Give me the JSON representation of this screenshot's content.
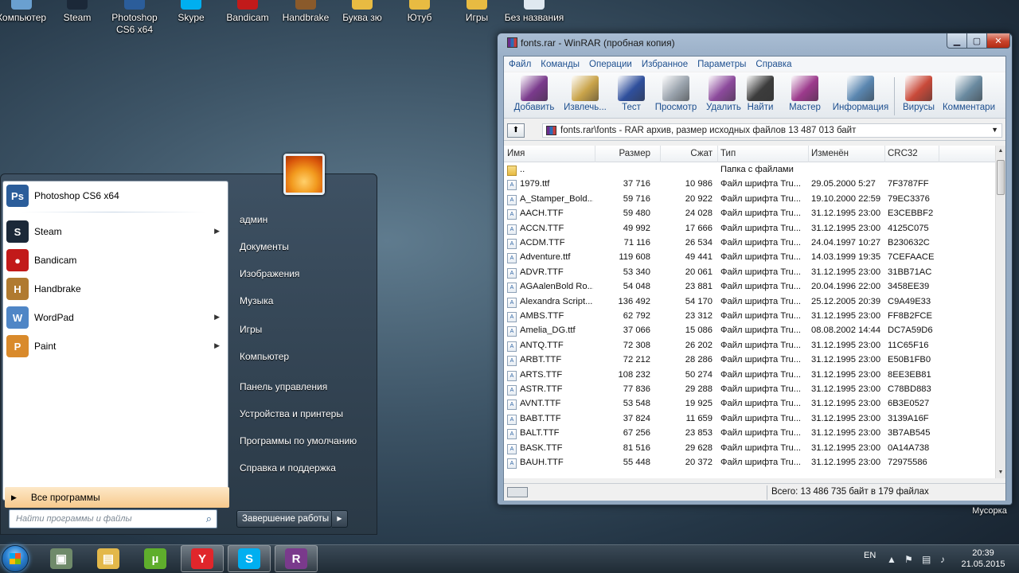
{
  "desktop_icons": [
    {
      "label": "Компьютер",
      "icon": "computer-icon",
      "color": "#6aa0d0"
    },
    {
      "label": "Steam",
      "icon": "steam-icon",
      "color": "#1b2838"
    },
    {
      "label": "Photoshop CS6 x64",
      "icon": "photoshop-icon",
      "color": "#2b5d9a"
    },
    {
      "label": "Skype",
      "icon": "skype-icon",
      "color": "#00aff0"
    },
    {
      "label": "Bandicam",
      "icon": "bandicam-icon",
      "color": "#c21a1a"
    },
    {
      "label": "Handbrake",
      "icon": "handbrake-icon",
      "color": "#8a5a2b"
    },
    {
      "label": "Буква зю",
      "icon": "folder-icon",
      "color": "#e8bb42"
    },
    {
      "label": "Ютуб",
      "icon": "folder-icon",
      "color": "#e8bb42"
    },
    {
      "label": "Игры",
      "icon": "folder-icon",
      "color": "#e8bb42"
    },
    {
      "label": "Без названия",
      "icon": "file-icon",
      "color": "#dfe8f0"
    }
  ],
  "recycle_bin": {
    "label": "Мусорка",
    "icon": "recycle-bin-icon"
  },
  "start_menu": {
    "pinned": [
      {
        "label": "Photoshop CS6 x64",
        "icon": "photoshop-icon",
        "glyph": "Ps",
        "color": "#2b5d9a",
        "submenu": false
      },
      {
        "label": "Steam",
        "icon": "steam-icon",
        "glyph": "S",
        "color": "#1b2838",
        "submenu": true
      },
      {
        "label": "Bandicam",
        "icon": "bandicam-icon",
        "glyph": "●",
        "color": "#c21a1a",
        "submenu": false
      },
      {
        "label": "Handbrake",
        "icon": "handbrake-icon",
        "glyph": "H",
        "color": "#b07a30",
        "submenu": false
      },
      {
        "label": "WordPad",
        "icon": "wordpad-icon",
        "glyph": "W",
        "color": "#4f86c6",
        "submenu": true
      },
      {
        "label": "Paint",
        "icon": "paint-icon",
        "glyph": "P",
        "color": "#d98a2b",
        "submenu": true
      }
    ],
    "all_programs": "Все программы",
    "search_placeholder": "Найти программы и файлы",
    "right_links": [
      "админ",
      "Документы",
      "Изображения",
      "Музыка",
      "Игры",
      "Компьютер",
      "Панель управления",
      "Устройства и принтеры",
      "Программы по умолчанию",
      "Справка и поддержка"
    ],
    "shutdown": "Завершение работы"
  },
  "taskbar": {
    "buttons": [
      {
        "icon": "computer-icon",
        "glyph": "▣",
        "color": "#6f8a6a"
      },
      {
        "icon": "explorer-folder-icon",
        "glyph": "▤",
        "color": "#e3b84a"
      },
      {
        "icon": "utorrent-icon",
        "glyph": "µ",
        "color": "#5fae2c"
      },
      {
        "icon": "yandex-browser-icon",
        "glyph": "Y",
        "color": "#e0262b"
      },
      {
        "icon": "skype-icon",
        "glyph": "S",
        "color": "#00aff0"
      },
      {
        "icon": "winrar-icon",
        "glyph": "R",
        "color": "#7a3a8c"
      }
    ],
    "lang": "EN",
    "time": "20:39",
    "date": "21.05.2015"
  },
  "winrar": {
    "title": "fonts.rar - WinRAR (пробная копия)",
    "menu": [
      "Файл",
      "Команды",
      "Операции",
      "Избранное",
      "Параметры",
      "Справка"
    ],
    "toolbar": [
      {
        "label": "Добавить",
        "icon": "add-archive-icon",
        "color": "#7a3a8c"
      },
      {
        "label": "Извлечь...",
        "icon": "extract-icon",
        "color": "#c9a44a"
      },
      {
        "label": "Тест",
        "icon": "test-icon",
        "color": "#2f4f9c"
      },
      {
        "label": "Просмотр",
        "icon": "view-icon",
        "color": "#9aa3ad"
      },
      {
        "label": "Удалить",
        "icon": "delete-icon",
        "color": "#8c4a9c"
      },
      {
        "label": "Найти",
        "icon": "find-icon",
        "color": "#3c3c3c"
      },
      {
        "label": "Мастер",
        "icon": "wizard-icon",
        "color": "#9c3a8c"
      },
      {
        "label": "Информация",
        "icon": "info-icon",
        "color": "#5a86b0"
      },
      {
        "label": "Вирусы",
        "icon": "virus-scan-icon",
        "color": "#c94a3a"
      },
      {
        "label": "Комментари",
        "icon": "comment-icon",
        "color": "#6a8aa0"
      }
    ],
    "path": "fonts.rar\\fonts - RAR архив, размер исходных файлов 13 487 013 байт",
    "columns": [
      "Имя",
      "Размер",
      "Сжат",
      "Тип",
      "Изменён",
      "CRC32"
    ],
    "rows": [
      {
        "name": "..",
        "size": "",
        "packed": "",
        "type": "Папка с файлами",
        "modified": "",
        "crc": "",
        "folder": true
      },
      {
        "name": "1979.ttf",
        "size": "37 716",
        "packed": "10 986",
        "type": "Файл шрифта Tru...",
        "modified": "29.05.2000 5:27",
        "crc": "7F3787FF"
      },
      {
        "name": "A_Stamper_Bold...",
        "size": "59 716",
        "packed": "20 922",
        "type": "Файл шрифта Tru...",
        "modified": "19.10.2000 22:59",
        "crc": "79EC3376"
      },
      {
        "name": "AACH.TTF",
        "size": "59 480",
        "packed": "24 028",
        "type": "Файл шрифта Tru...",
        "modified": "31.12.1995 23:00",
        "crc": "E3CEBBF2"
      },
      {
        "name": "ACCN.TTF",
        "size": "49 992",
        "packed": "17 666",
        "type": "Файл шрифта Tru...",
        "modified": "31.12.1995 23:00",
        "crc": "4125C075"
      },
      {
        "name": "ACDM.TTF",
        "size": "71 116",
        "packed": "26 534",
        "type": "Файл шрифта Tru...",
        "modified": "24.04.1997 10:27",
        "crc": "B230632C"
      },
      {
        "name": "Adventure.ttf",
        "size": "119 608",
        "packed": "49 441",
        "type": "Файл шрифта Tru...",
        "modified": "14.03.1999 19:35",
        "crc": "7CEFAACE"
      },
      {
        "name": "ADVR.TTF",
        "size": "53 340",
        "packed": "20 061",
        "type": "Файл шрифта Tru...",
        "modified": "31.12.1995 23:00",
        "crc": "31BB71AC"
      },
      {
        "name": "AGAalenBold Ro...",
        "size": "54 048",
        "packed": "23 881",
        "type": "Файл шрифта Tru...",
        "modified": "20.04.1996 22:00",
        "crc": "3458EE39"
      },
      {
        "name": "Alexandra Script...",
        "size": "136 492",
        "packed": "54 170",
        "type": "Файл шрифта Tru...",
        "modified": "25.12.2005 20:39",
        "crc": "C9A49E33"
      },
      {
        "name": "AMBS.TTF",
        "size": "62 792",
        "packed": "23 312",
        "type": "Файл шрифта Tru...",
        "modified": "31.12.1995 23:00",
        "crc": "FF8B2FCE"
      },
      {
        "name": "Amelia_DG.ttf",
        "size": "37 066",
        "packed": "15 086",
        "type": "Файл шрифта Tru...",
        "modified": "08.08.2002 14:44",
        "crc": "DC7A59D6"
      },
      {
        "name": "ANTQ.TTF",
        "size": "72 308",
        "packed": "26 202",
        "type": "Файл шрифта Tru...",
        "modified": "31.12.1995 23:00",
        "crc": "11C65F16"
      },
      {
        "name": "ARBT.TTF",
        "size": "72 212",
        "packed": "28 286",
        "type": "Файл шрифта Tru...",
        "modified": "31.12.1995 23:00",
        "crc": "E50B1FB0"
      },
      {
        "name": "ARTS.TTF",
        "size": "108 232",
        "packed": "50 274",
        "type": "Файл шрифта Tru...",
        "modified": "31.12.1995 23:00",
        "crc": "8EE3EB81"
      },
      {
        "name": "ASTR.TTF",
        "size": "77 836",
        "packed": "29 288",
        "type": "Файл шрифта Tru...",
        "modified": "31.12.1995 23:00",
        "crc": "C78BD883"
      },
      {
        "name": "AVNT.TTF",
        "size": "53 548",
        "packed": "19 925",
        "type": "Файл шрифта Tru...",
        "modified": "31.12.1995 23:00",
        "crc": "6B3E0527"
      },
      {
        "name": "BABT.TTF",
        "size": "37 824",
        "packed": "11 659",
        "type": "Файл шрифта Tru...",
        "modified": "31.12.1995 23:00",
        "crc": "3139A16F"
      },
      {
        "name": "BALT.TTF",
        "size": "67 256",
        "packed": "23 853",
        "type": "Файл шрифта Tru...",
        "modified": "31.12.1995 23:00",
        "crc": "3B7AB545"
      },
      {
        "name": "BASK.TTF",
        "size": "81 516",
        "packed": "29 628",
        "type": "Файл шрифта Tru...",
        "modified": "31.12.1995 23:00",
        "crc": "0A14A738"
      },
      {
        "name": "BAUH.TTF",
        "size": "55 448",
        "packed": "20 372",
        "type": "Файл шрифта Tru...",
        "modified": "31.12.1995 23:00",
        "crc": "72975586"
      }
    ],
    "status": "Всего: 13 486 735 байт в 179 файлах"
  }
}
